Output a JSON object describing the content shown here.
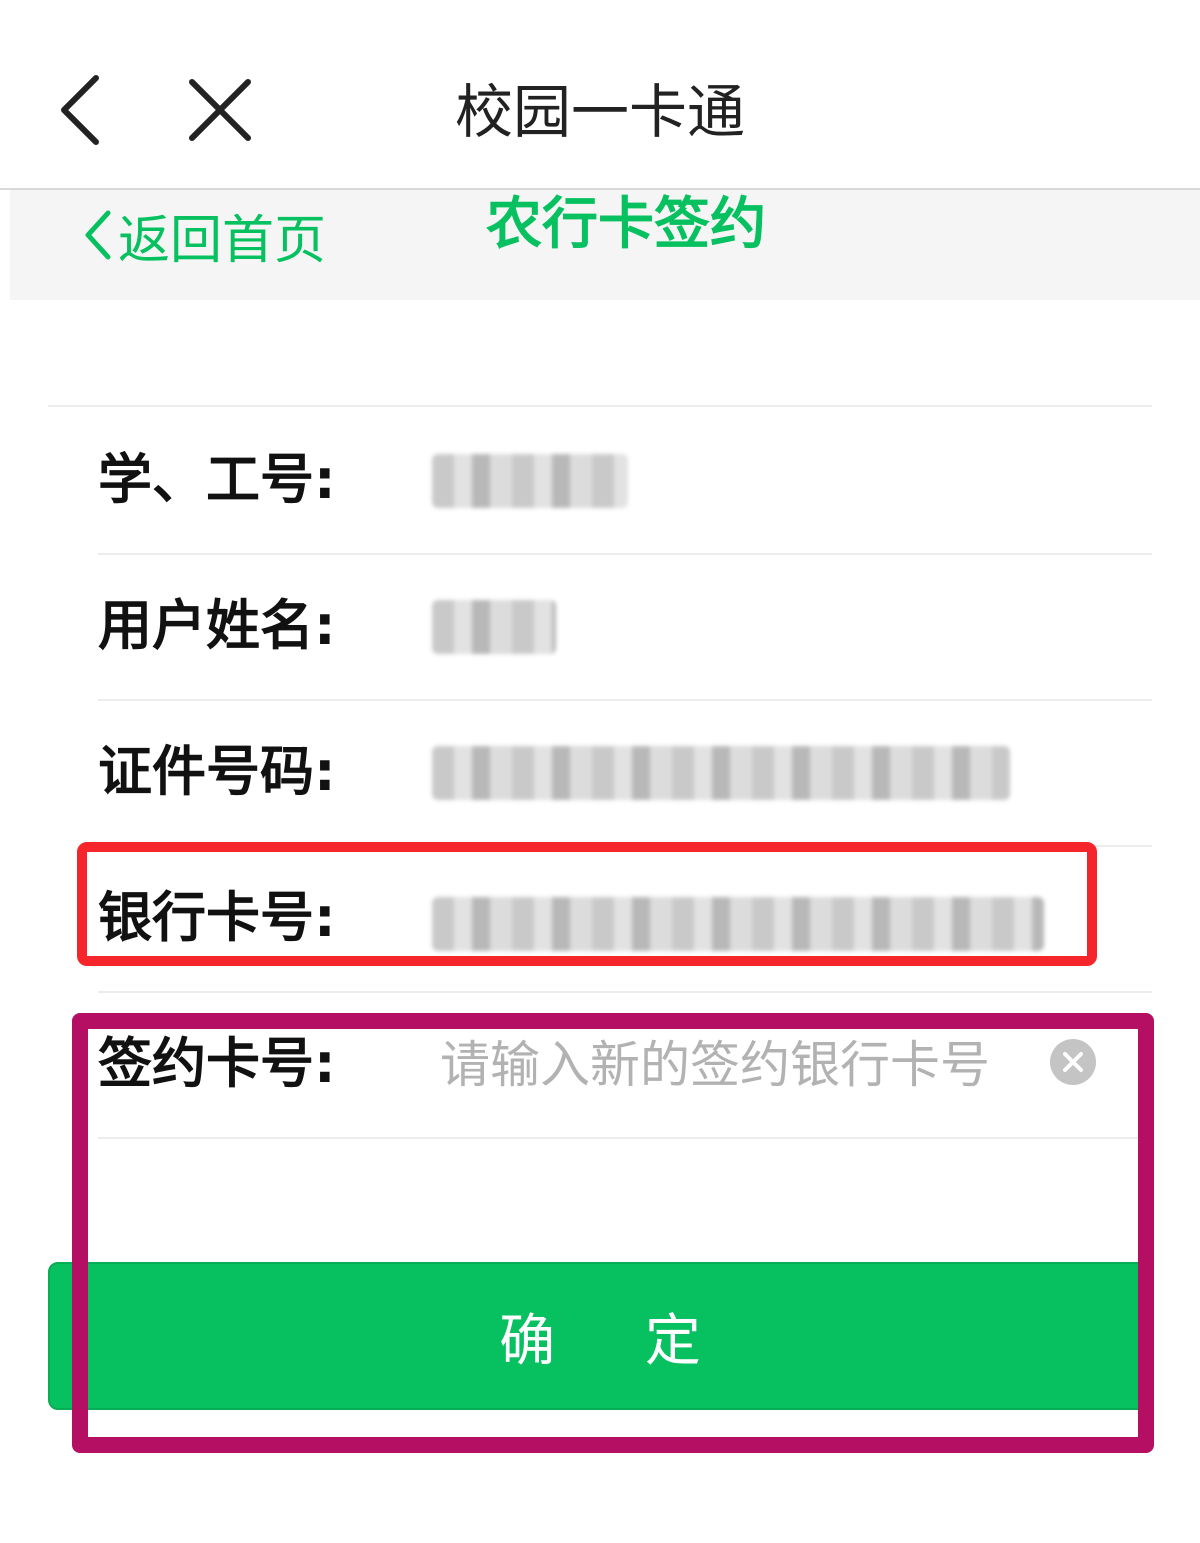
{
  "navbar": {
    "title": "校园一卡通",
    "back_icon": "chevron-left-icon",
    "close_icon": "close-icon"
  },
  "subheader": {
    "back_label": "返回首页",
    "title": "农行卡签约"
  },
  "form": {
    "rows": [
      {
        "label": "学、工号:",
        "value_redacted": true
      },
      {
        "label": "用户姓名:",
        "value_redacted": true
      },
      {
        "label": "证件号码:",
        "value_redacted": true
      },
      {
        "label": "银行卡号:",
        "value_redacted": true
      },
      {
        "label": "签约卡号:",
        "placeholder": "请输入新的签约银行卡号",
        "value": ""
      }
    ]
  },
  "confirm_label": "确 定",
  "colors": {
    "accent": "#07c160",
    "highlight_red": "#f5262b",
    "highlight_magenta": "#b40f62"
  }
}
